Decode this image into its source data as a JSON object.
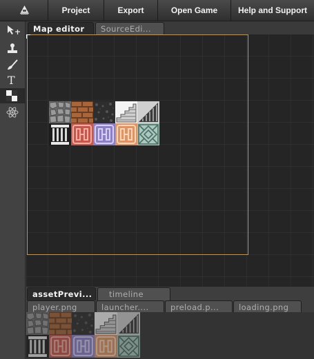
{
  "menu": {
    "logo_icon": "engine-logo-icon",
    "items": [
      "Project",
      "Export",
      "Open Game",
      "Help and Support"
    ]
  },
  "toolbar": {
    "tools": [
      {
        "name": "select-move-tool",
        "icon": "arrow-move-icon"
      },
      {
        "name": "stamp-tool",
        "icon": "stamp-icon"
      },
      {
        "name": "brush-tool",
        "icon": "brush-icon"
      },
      {
        "name": "text-tool",
        "icon": "text-icon"
      },
      {
        "name": "tile-tool",
        "icon": "checker-icon",
        "active": true
      },
      {
        "name": "physics-tool",
        "icon": "atom-icon"
      }
    ]
  },
  "editor_tabs": {
    "active": "Map editor",
    "inactive": "SourceEdi..."
  },
  "map_tiles": {
    "row1": [
      "cobblestone",
      "brick",
      "dark-stone",
      "stairs-light",
      "stairs-dark"
    ],
    "row2": [
      "column",
      "red-ornate",
      "purple-ornate",
      "orange-ornate",
      "green-ornate"
    ]
  },
  "panel_tabs": {
    "active": "assetPrevi...",
    "inactive": "timeline"
  },
  "asset_tabs": [
    "player.png",
    "launcher....",
    "preload.p...",
    "loading.png"
  ],
  "colors": {
    "map_bounds": "#d9922b",
    "background": "#252525"
  }
}
